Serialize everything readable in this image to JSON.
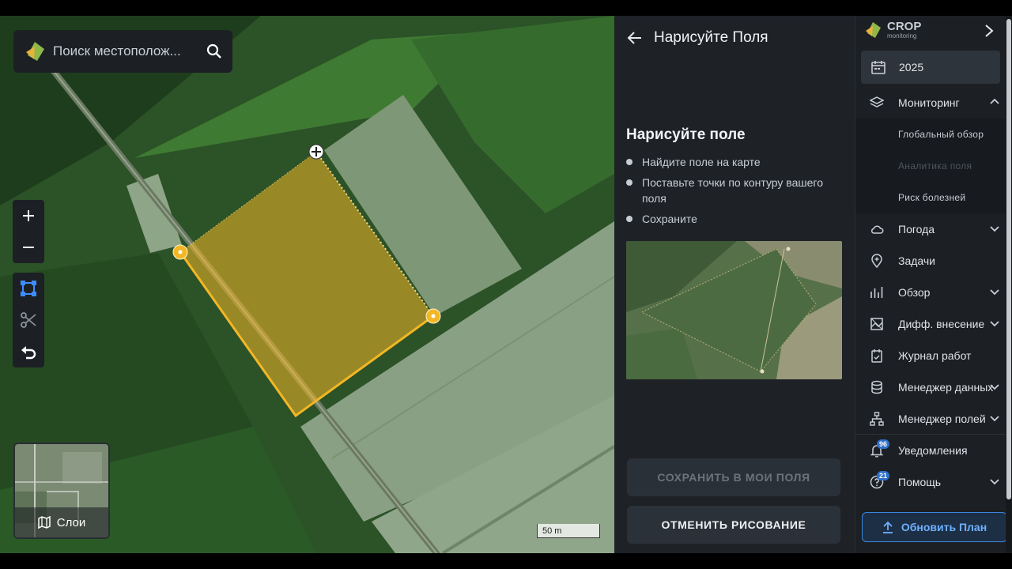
{
  "search": {
    "placeholder": "Поиск местополож..."
  },
  "map": {
    "zoom_in_icon": "plus-icon",
    "zoom_out_icon": "minus-icon",
    "tools": [
      "polygon-draw-icon",
      "scissors-icon",
      "undo-icon"
    ],
    "layers_label": "Слои",
    "scale_label": "50 m",
    "field_color": "#f3b625"
  },
  "draw_panel": {
    "title": "Нарисуйте Поля",
    "heading": "Нарисуйте поле",
    "steps": [
      "Найдите поле на карте",
      "Поставьте точки по контуру вашего поля",
      "Сохраните"
    ],
    "save_button": "СОХРАНИТЬ В МОИ ПОЛЯ",
    "cancel_button": "ОТМЕНИТЬ РИСОВАНИЕ"
  },
  "sidebar": {
    "brand": "CROP",
    "brand_sub": "monitoring",
    "year": "2025",
    "items": {
      "monitoring": "Мониторинг",
      "global_overview": "Глобальный обзор",
      "field_analytics": "Аналитика поля",
      "disease_risk": "Риск болезней",
      "weather": "Погода",
      "tasks": "Задачи",
      "overview": "Обзор",
      "diff_application": "Дифф. внесение",
      "work_log": "Журнал работ",
      "data_manager": "Менеджер данных",
      "field_manager": "Менеджер полей",
      "notifications": "Уведомления",
      "help": "Помощь"
    },
    "notifications_badge": "96",
    "help_badge": "21",
    "upgrade_button": "Обновить План",
    "accent": "#3d86e0"
  }
}
